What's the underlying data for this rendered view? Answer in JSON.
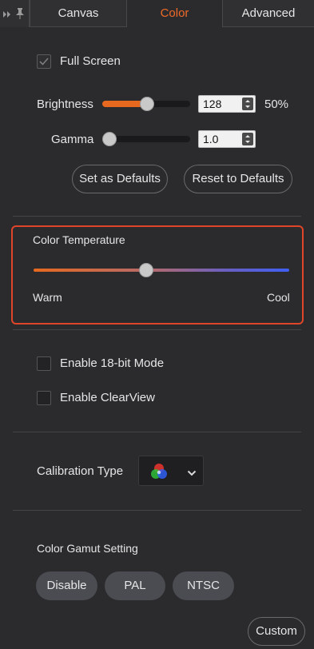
{
  "tabs": [
    {
      "label": "Canvas"
    },
    {
      "label": "Color"
    },
    {
      "label": "Advanced"
    }
  ],
  "full_screen": {
    "label": "Full Screen",
    "checked": true
  },
  "brightness": {
    "label": "Brightness",
    "value": "128",
    "percent": "50%",
    "level": 0.5
  },
  "gamma": {
    "label": "Gamma",
    "value": "1.0",
    "level": 0.0
  },
  "defaults": {
    "set_label": "Set as Defaults",
    "reset_label": "Reset to Defaults"
  },
  "color_temperature": {
    "title": "Color Temperature",
    "warm_label": "Warm",
    "cool_label": "Cool",
    "level": 0.44
  },
  "enable_18bit": {
    "label": "Enable 18-bit Mode",
    "checked": false
  },
  "enable_clearview": {
    "label": "Enable ClearView",
    "checked": false
  },
  "calibration": {
    "label": "Calibration Type",
    "icon": "rgb-circles-icon"
  },
  "gamut": {
    "title": "Color Gamut Setting",
    "options": [
      "Disable",
      "PAL",
      "NTSC"
    ],
    "custom_label": "Custom"
  },
  "colors": {
    "accent": "#ef6a28",
    "highlight_border": "#e0452a"
  }
}
